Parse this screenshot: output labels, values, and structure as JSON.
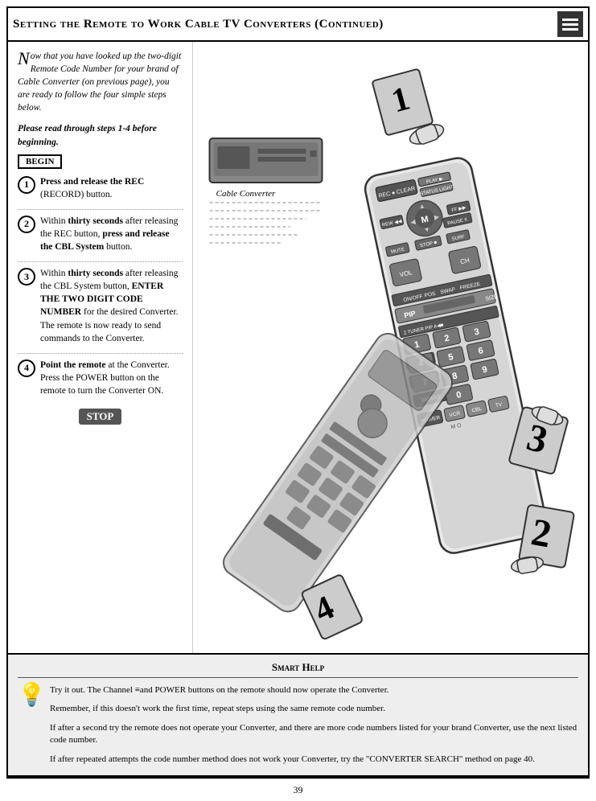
{
  "header": {
    "title": "Setting the Remote to Work Cable TV Converters (Continued)"
  },
  "intro": {
    "text": "ow that you have looked up the two-digit Remote Code Number for your brand of Cable Converter (on previous page), you are ready to follow the four simple steps below."
  },
  "bold_instruction": "Please read through steps 1-4 before beginning.",
  "begin_label": "BEGIN",
  "steps": [
    {
      "number": "1",
      "text": "Press and release the REC (RECORD) button."
    },
    {
      "number": "2",
      "text": "Within thirty seconds after releasing the REC button, press and release the CBL System button."
    },
    {
      "number": "3",
      "text": "Within thirty seconds after releasing the CBL System button, ENTER THE TWO DIGIT CODE NUMBER for the desired Converter. The remote is now ready to send commands to the Converter."
    },
    {
      "number": "4",
      "text": "Point the remote at the Converter. Press the POWER button on the remote to turn the Converter ON."
    }
  ],
  "stop_label": "STOP",
  "smart_help": {
    "title": "Smart Help",
    "paragraphs": [
      "Try it out. The Channel and POWER buttons on the remote should now operate the Converter.",
      "Remember, if this doesn't work the first time, repeat steps using the same remote code number.",
      "If after a second try the remote does not operate your Converter, and there are more code numbers listed for your brand Converter, use the next listed code number.",
      "If after repeated attempts the code number method does not work your Converter, try the \"CONVERTER SEARCH\" method on page 40."
    ]
  },
  "cable_converter_label": "Cable Converter",
  "page_number": "39",
  "step_numbers_large": [
    "1",
    "2",
    "3",
    "4"
  ]
}
